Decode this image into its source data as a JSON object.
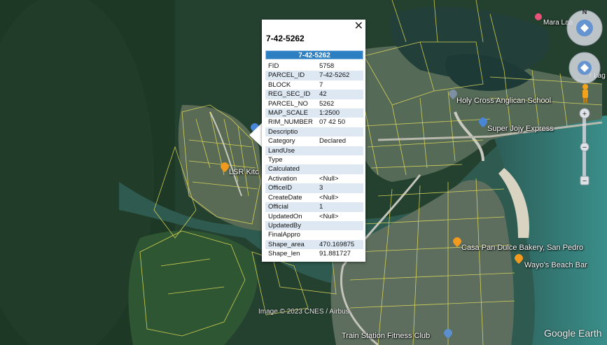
{
  "map": {
    "copyright": "Image © 2023 CNES / Airbus",
    "logo": "Google Earth",
    "places": [
      {
        "name": "Holy Cross Anglican School",
        "icon": "school-pin-icon"
      },
      {
        "name": "Super Jojy Express",
        "icon": "store-pin-icon"
      },
      {
        "name": "Casa Pan Dulce Bakery, San Pedro",
        "icon": "food-pin-icon"
      },
      {
        "name": "Wayo's Beach Bar",
        "icon": "food-pin-icon"
      },
      {
        "name": "Train Station Fitness Club",
        "icon": "gym-pin-icon"
      },
      {
        "name": "Mara Laa",
        "icon": "hotel-pin-icon"
      },
      {
        "name": "LSR Kitc",
        "icon": "food-pin-icon"
      },
      {
        "name": "r Lag",
        "icon": "place-icon"
      }
    ],
    "colors": {
      "parcel_lines": "#e9e35a",
      "popup_header": "#2c7fc1",
      "row_alt": "#dde8f3"
    }
  },
  "popup": {
    "title": "7-42-5262",
    "header": "7-42-5262",
    "rows": [
      {
        "key": "FID",
        "value": "5758"
      },
      {
        "key": "PARCEL_ID",
        "value": "7-42-5262"
      },
      {
        "key": "BLOCK",
        "value": "7"
      },
      {
        "key": "REG_SEC_ID",
        "value": "42"
      },
      {
        "key": "PARCEL_NO",
        "value": "5262"
      },
      {
        "key": "MAP_SCALE",
        "value": "1:2500"
      },
      {
        "key": "RIM_NUMBER",
        "value": "07 42 50"
      },
      {
        "key": "Descriptio",
        "value": ""
      },
      {
        "key": "Category",
        "value": "Declared"
      },
      {
        "key": "LandUse",
        "value": ""
      },
      {
        "key": "Type",
        "value": ""
      },
      {
        "key": "Calculated",
        "value": ""
      },
      {
        "key": "Activation",
        "value": "<Null>"
      },
      {
        "key": "OfficeID",
        "value": "3"
      },
      {
        "key": "CreateDate",
        "value": "<Null>"
      },
      {
        "key": "Official",
        "value": "1"
      },
      {
        "key": "UpdatedOn",
        "value": "<Null>"
      },
      {
        "key": "UpdatedBy",
        "value": ""
      },
      {
        "key": "FinalAppro",
        "value": ""
      },
      {
        "key": "Shape_area",
        "value": "470.169875"
      },
      {
        "key": "Shape_len",
        "value": "91.881727"
      }
    ]
  },
  "nav": {
    "compass_label": "N"
  }
}
